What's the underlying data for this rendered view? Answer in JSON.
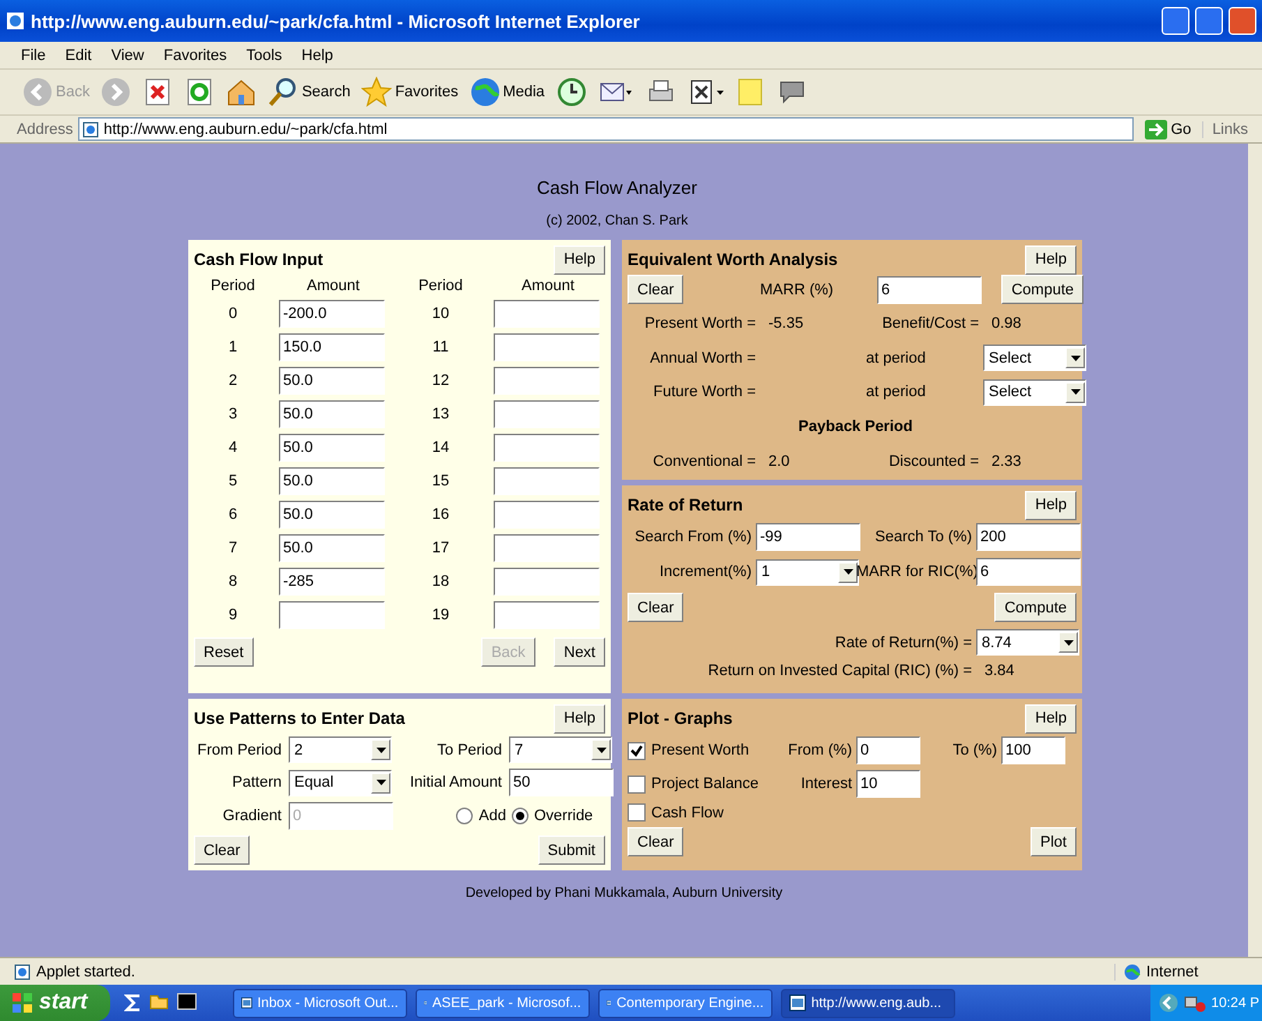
{
  "window": {
    "title": "http://www.eng.auburn.edu/~park/cfa.html - Microsoft Internet Explorer"
  },
  "menu": [
    "File",
    "Edit",
    "View",
    "Favorites",
    "Tools",
    "Help"
  ],
  "toolbar": [
    {
      "kind": "back",
      "label": "Back",
      "disabled": true
    },
    {
      "kind": "forward",
      "disabled": true
    },
    {
      "kind": "stop"
    },
    {
      "kind": "refresh"
    },
    {
      "kind": "home"
    },
    {
      "kind": "search",
      "label": "Search"
    },
    {
      "kind": "favorites",
      "label": "Favorites"
    },
    {
      "kind": "media",
      "label": "Media"
    },
    {
      "kind": "history"
    },
    {
      "kind": "mail"
    },
    {
      "kind": "print"
    },
    {
      "kind": "edit"
    },
    {
      "kind": "note"
    },
    {
      "kind": "messenger"
    }
  ],
  "address_bar": {
    "label": "Address",
    "url": "http://www.eng.auburn.edu/~park/cfa.html",
    "go": "Go",
    "links": "Links"
  },
  "page": {
    "title": "Cash Flow Analyzer",
    "copyright": "(c) 2002, Chan S. Park",
    "cash_flow_input": {
      "title": "Cash Flow Input",
      "help": "Help",
      "columns": [
        "Period",
        "Amount",
        "Period",
        "Amount"
      ],
      "periods": [
        {
          "period": "0",
          "amount": "-200.0"
        },
        {
          "period": "1",
          "amount": "150.0"
        },
        {
          "period": "2",
          "amount": "50.0"
        },
        {
          "period": "3",
          "amount": "50.0"
        },
        {
          "period": "4",
          "amount": "50.0"
        },
        {
          "period": "5",
          "amount": "50.0"
        },
        {
          "period": "6",
          "amount": "50.0"
        },
        {
          "period": "7",
          "amount": "50.0"
        },
        {
          "period": "8",
          "amount": "-285"
        },
        {
          "period": "9"
        },
        {
          "period": "10"
        },
        {
          "period": "11"
        },
        {
          "period": "12"
        },
        {
          "period": "13"
        },
        {
          "period": "14"
        },
        {
          "period": "15"
        },
        {
          "period": "16"
        },
        {
          "period": "17"
        },
        {
          "period": "18"
        },
        {
          "period": "19"
        }
      ],
      "buttons": [
        {
          "label": "Reset",
          "disabled": false
        },
        {
          "label": "Back",
          "disabled": true
        },
        {
          "label": "Next",
          "disabled": false
        }
      ]
    },
    "patterns": {
      "title": "Use Patterns to Enter Data",
      "help": "Help",
      "from_period": {
        "label": "From Period",
        "value": "2"
      },
      "to_period": {
        "label": "To Period",
        "value": "7"
      },
      "pattern": {
        "label": "Pattern",
        "value": "Equal"
      },
      "initial_amount": {
        "label": "Initial Amount",
        "value": "50"
      },
      "gradient": {
        "label": "Gradient",
        "value": "0",
        "disabled": true
      },
      "modes": [
        {
          "label": "Add",
          "selected": false
        },
        {
          "label": "Override",
          "selected": true
        }
      ],
      "clear": "Clear",
      "submit": "Submit"
    },
    "equivalent_worth": {
      "title": "Equivalent Worth Analysis",
      "help": "Help",
      "clear": "Clear",
      "marr": {
        "label": "MARR (%)",
        "value": "6"
      },
      "compute": "Compute",
      "present_worth": {
        "label": "Present Worth =",
        "value": "-5.35"
      },
      "benefit_cost": {
        "label": "Benefit/Cost =",
        "value": "0.98"
      },
      "annual_worth": {
        "label": "Annual Worth =",
        "period_label": "at period",
        "select": "Select"
      },
      "future_worth": {
        "label": "Future Worth =",
        "period_label": "at period",
        "select": "Select"
      },
      "payback_title": "Payback Period",
      "conventional": {
        "label": "Conventional =",
        "value": "2.0"
      },
      "discounted": {
        "label": "Discounted =",
        "value": "2.33"
      }
    },
    "rate_of_return": {
      "title": "Rate of Return",
      "help": "Help",
      "search_from": {
        "label": "Search From (%)",
        "value": "-99"
      },
      "search_to": {
        "label": "Search To (%)",
        "value": "200"
      },
      "increment": {
        "label": "Increment(%)",
        "value": "1"
      },
      "marr_ric": {
        "label": "MARR for RIC(%)",
        "value": "6"
      },
      "clear": "Clear",
      "compute": "Compute",
      "rate": {
        "label": "Rate of Return(%) =",
        "value": "8.74"
      },
      "ric": {
        "label": "Return on Invested Capital (RIC) (%) =",
        "value": "3.84"
      }
    },
    "plot": {
      "title": "Plot - Graphs",
      "help": "Help",
      "options": [
        {
          "label": "Present Worth",
          "checked": true
        },
        {
          "label": "Project Balance",
          "checked": false
        },
        {
          "label": "Cash Flow",
          "checked": false
        }
      ],
      "from": {
        "label": "From (%)",
        "value": "0"
      },
      "to": {
        "label": "To (%)",
        "value": "100"
      },
      "interest": {
        "label": "Interest",
        "value": "10"
      },
      "clear": "Clear",
      "plot": "Plot"
    },
    "footer": "Developed by Phani Mukkamala, Auburn University"
  },
  "status_bar": {
    "text": "Applet started.",
    "zone": "Internet"
  },
  "taskbar": {
    "start": "start",
    "tasks": [
      {
        "label": "Inbox - Microsoft Out...",
        "selected": false
      },
      {
        "label": "ASEE_park - Microsof...",
        "selected": false
      },
      {
        "label": "Contemporary Engine...",
        "selected": false
      },
      {
        "label": "http://www.eng.aub...",
        "selected": true
      }
    ],
    "clock": "10:24 P"
  }
}
